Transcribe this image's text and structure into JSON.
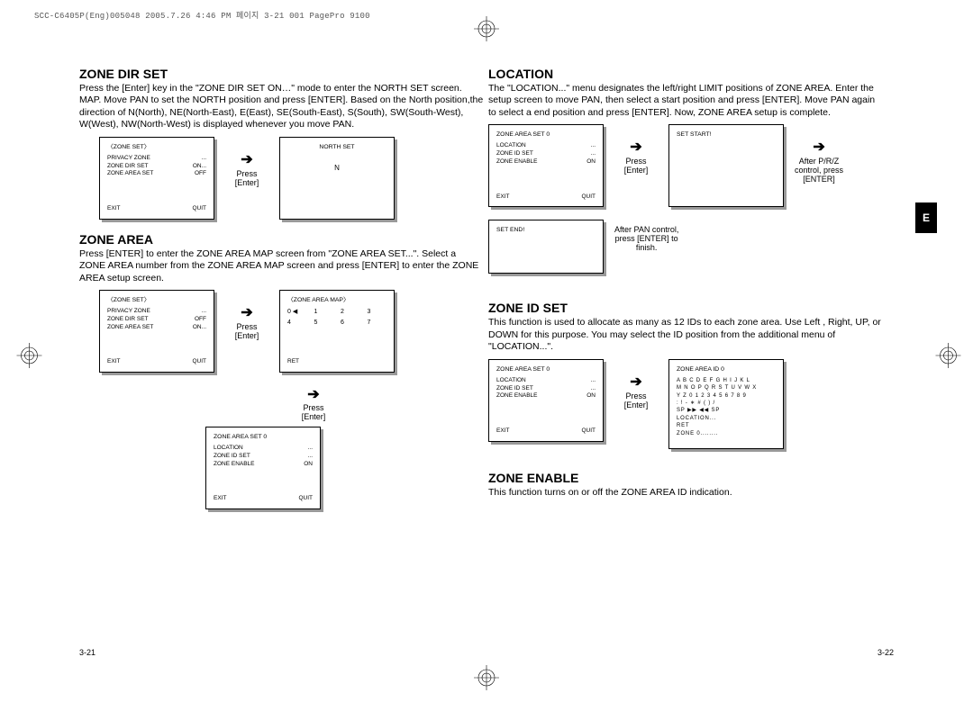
{
  "header_line": "SCC-C6405P(Eng)005048  2005.7.26 4:46 PM 페이지 3-21   001 PagePro 9100",
  "side_tab": "E",
  "page_num_left": "3-21",
  "page_num_right": "3-22",
  "left": {
    "s1": {
      "title": "ZONE DIR SET",
      "body": "Press the [Enter] key in the \"ZONE DIR SET ON…\" mode to enter the NORTH SET screen. MAP. Move PAN to set the NORTH position and press [ENTER]. Based on the North position,the direction of N(North), NE(North-East), E(East), SE(South-East), S(South), SW(South-West), W(West), NW(North-West) is displayed whenever you move PAN.",
      "osd1": {
        "title": "〈ZONE SET〉",
        "l1a": "PRIVACY ZONE",
        "l1b": "...",
        "l2a": "ZONE DIR SET",
        "l2b": "ON...",
        "l3a": "ZONE AREA SET",
        "l3b": "OFF",
        "fa": "EXIT",
        "fb": "QUIT"
      },
      "osd2": {
        "title": "NORTH SET",
        "center": "N"
      },
      "step": {
        "a": "Press",
        "b": "[Enter]"
      }
    },
    "s2": {
      "title": "ZONE AREA",
      "body": "Press [ENTER] to enter the ZONE AREA MAP screen from \"ZONE AREA SET...\". Select a ZONE AREA number from the ZONE AREA MAP screen and press [ENTER] to enter the ZONE AREA setup screen.",
      "osd1": {
        "title": "〈ZONE SET〉",
        "l1a": "PRIVACY ZONE",
        "l1b": "...",
        "l2a": "ZONE DIR SET",
        "l2b": "OFF",
        "l3a": "ZONE AREA SET",
        "l3b": "ON...",
        "fa": "EXIT",
        "fb": "QUIT"
      },
      "osd2": {
        "title": "〈ZONE AREA MAP〉",
        "g0": "0 ◀",
        "g1": "1",
        "g2": "2",
        "g3": "3",
        "g4": "4",
        "g5": "5",
        "g6": "6",
        "g7": "7",
        "ret": "RET"
      },
      "osd3": {
        "title": "ZONE AREA SET    0",
        "l1a": "LOCATION",
        "l1b": "...",
        "l2a": "ZONE ID SET",
        "l2b": "...",
        "l3a": "ZONE ENABLE",
        "l3b": "ON",
        "fa": "EXIT",
        "fb": "QUIT"
      },
      "step": {
        "a": "Press",
        "b": "[Enter]"
      }
    }
  },
  "right": {
    "s1": {
      "title": "LOCATION",
      "body": "The \"LOCATION...\" menu designates the left/right LIMIT positions of ZONE AREA. Enter the setup screen to move PAN, then select a start position and press [ENTER]. Move PAN again\nto select a end position and press [ENTER].  Now, ZONE AREA setup is complete.",
      "osd1": {
        "title": "ZONE AREA SET    0",
        "l1a": "LOCATION",
        "l1b": "...",
        "l2a": "ZONE ID SET",
        "l2b": "...",
        "l3a": "ZONE ENABLE",
        "l3b": "ON",
        "fa": "EXIT",
        "fb": "QUIT"
      },
      "osd2": {
        "title": "SET START!"
      },
      "osd3": {
        "title": "SET END!"
      },
      "step1": {
        "a": "Press",
        "b": "[Enter]"
      },
      "step2": {
        "a": "After P/R/Z",
        "b": "control, press",
        "c": "[ENTER]"
      },
      "step3": {
        "a": "After PAN control,",
        "b": "press [ENTER] to",
        "c": "finish."
      }
    },
    "s2": {
      "title": "ZONE ID SET",
      "body": "This function is used to allocate as many as 12 IDs to each zone area. Use Left , Right, UP, or DOWN for this purpose. You may select the ID position from the additional menu  of \"LOCATION...\".",
      "osd1": {
        "title": "ZONE AREA SET    0",
        "l1a": "LOCATION",
        "l1b": "...",
        "l2a": "ZONE ID SET",
        "l2b": "...",
        "l3a": "ZONE ENABLE",
        "l3b": "ON",
        "fa": "EXIT",
        "fb": "QUIT"
      },
      "osd2": {
        "title": "ZONE AREA ID 0",
        "row1": "A B C D E F G H I J K L",
        "row2": "M N O P Q R S T U V W X",
        "row3": "Y Z 0 1 2 3 4 5 6 7 8 9",
        "row4": ": ! - ∗ # ( ) /",
        "row5": "SP ▶▶ ◀◀ SP",
        "row6": "LOCATION...",
        "row7": "RET",
        "row8": "ZONE 0........"
      },
      "step": {
        "a": "Press",
        "b": "[Enter]"
      }
    },
    "s3": {
      "title": "ZONE ENABLE",
      "body": "This function turns on or off the ZONE AREA ID indication."
    }
  }
}
